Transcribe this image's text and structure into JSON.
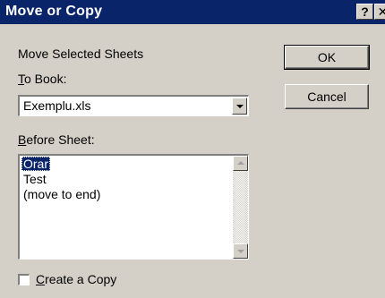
{
  "window": {
    "title": "Move or Copy",
    "help_glyph": "?",
    "close_glyph": "✕"
  },
  "dialog": {
    "heading": "Move Selected Sheets",
    "to_book_label": {
      "mnemonic": "T",
      "rest": "o Book:"
    },
    "to_book_value": "Exemplu.xls",
    "before_sheet_label": {
      "mnemonic": "B",
      "rest": "efore Sheet:"
    },
    "sheets": [
      {
        "label": "Orar",
        "selected": true
      },
      {
        "label": "Test",
        "selected": false
      },
      {
        "label": "(move to end)",
        "selected": false
      }
    ],
    "create_copy_label": {
      "mnemonic": "C",
      "rest": "reate a Copy"
    },
    "create_copy_checked": false
  },
  "buttons": {
    "ok": "OK",
    "cancel": "Cancel"
  },
  "icons": {
    "dropdown": "chevron-down-icon",
    "scroll_up": "scroll-up-arrow-icon",
    "scroll_down": "scroll-down-arrow-icon"
  },
  "colors": {
    "titlebar": "#0a246a",
    "face": "#d4d0c8",
    "selection": "#0a246a"
  }
}
